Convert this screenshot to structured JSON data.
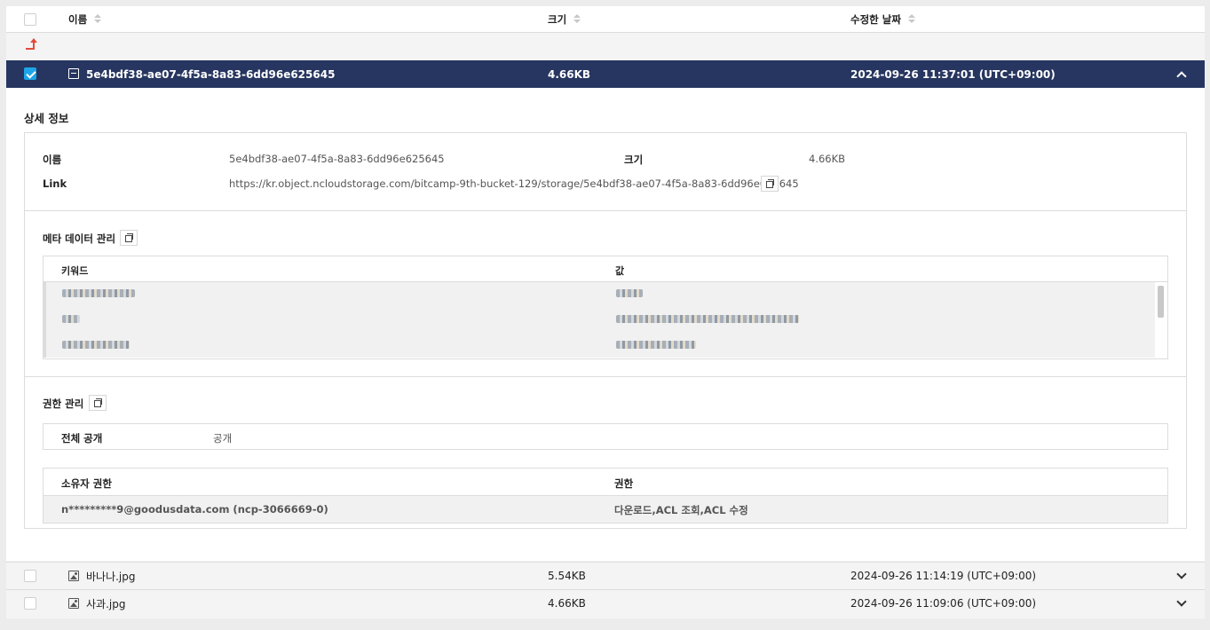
{
  "header": {
    "name": "이름",
    "size": "크기",
    "modified": "수정한 날짜"
  },
  "selected": {
    "name": "5e4bdf38-ae07-4f5a-8a83-6dd96e625645",
    "size": "4.66KB",
    "date": "2024-09-26 11:37:01 (UTC+09:00)"
  },
  "detail": {
    "title": "상세 정보",
    "name_label": "이름",
    "name_value": "5e4bdf38-ae07-4f5a-8a83-6dd96e625645",
    "size_label": "크기",
    "size_value": "4.66KB",
    "link_label": "Link",
    "link_value": "https://kr.object.ncloudstorage.com/bitcamp-9th-bucket-129/storage/5e4bdf38-ae07-4f5a-8a83-6dd96e625645"
  },
  "metadata": {
    "title": "메타 데이터 관리",
    "col_key": "키워드",
    "col_value": "값"
  },
  "permission": {
    "title": "권한 관리",
    "public_label": "전체 공개",
    "public_value": "공개",
    "owner_col": "소유자 권한",
    "perm_col": "권한",
    "owner": "n*********9@goodusdata.com (ncp-3066669-0)",
    "perms": "다운로드,ACL 조회,ACL 수정"
  },
  "files": [
    {
      "name": "바나나.jpg",
      "size": "5.54KB",
      "date": "2024-09-26 11:14:19 (UTC+09:00)"
    },
    {
      "name": "사과.jpg",
      "size": "4.66KB",
      "date": "2024-09-26 11:09:06 (UTC+09:00)"
    }
  ],
  "icons": [
    "checkbox-icon",
    "sort-icon",
    "parent-folder-icon",
    "file-icon",
    "image-icon",
    "copy-icon",
    "chevron-up-icon",
    "chevron-down-icon"
  ]
}
